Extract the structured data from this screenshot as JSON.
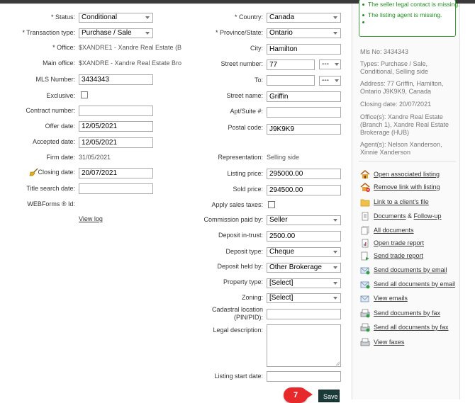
{
  "colors": {
    "accent_green": "#1f8f1f",
    "save_button_bg": "#1b3b3b",
    "step_badge": "#e8292c"
  },
  "left": {
    "status_label": "* Status:",
    "status_value": "Conditional",
    "transaction_type_label": "* Transaction type:",
    "transaction_type_value": "Purchase / Sale",
    "office_label": "* Office:",
    "office_value": "$XANDRE1 - Xandre Real Estate (Br...",
    "main_office_label": "Main office:",
    "main_office_value": "$XANDRE - Xandre Real Estate Bro...",
    "mls_label": "MLS Number:",
    "mls_value": "3434343",
    "exclusive_label": "Exclusive:",
    "contract_label": "Contract number:",
    "contract_value": "",
    "offer_label": "Offer date:",
    "offer_value": "12/05/2021",
    "accepted_label": "Accepted date:",
    "accepted_value": "12/05/2021",
    "firm_label": "Firm date:",
    "firm_value": "31/05/2021",
    "closing_label": "Closing date:",
    "closing_value": "20/07/2021",
    "title_search_label": "Title search date:",
    "title_search_value": "",
    "webforms_label": "WEBForms ® Id:",
    "view_log": "View log"
  },
  "right": {
    "country_label": "* Country:",
    "country_value": "Canada",
    "province_label": "* Province/State:",
    "province_value": "Ontario",
    "city_label": "City:",
    "city_value": "Hamilton",
    "street_number_label": "Street number:",
    "street_number_value": "77",
    "street_number_suffix": "---",
    "to_label": "To:",
    "to_value": "",
    "to_suffix": "---",
    "street_name_label": "Street name:",
    "street_name_value": "Griffin",
    "apt_label": "Apt/Suite #:",
    "apt_value": "",
    "postal_label": "Postal code:",
    "postal_value": "J9K9K9",
    "representation_label": "Representation:",
    "representation_value": "Selling side",
    "listing_price_label": "Listing price:",
    "listing_price_value": "295000.00",
    "sold_price_label": "Sold price:",
    "sold_price_value": "294500.00",
    "taxes_label": "Apply sales taxes:",
    "commission_label": "Commission paid by:",
    "commission_value": "Seller",
    "deposit_trust_label": "Deposit in-trust:",
    "deposit_trust_value": "2500.00",
    "deposit_type_label": "Deposit type:",
    "deposit_type_value": "Cheque",
    "deposit_held_label": "Deposit held by:",
    "deposit_held_value": "Other Brokerage",
    "property_type_label": "Property type:",
    "property_type_value": "[Select]",
    "zoning_label": "Zoning:",
    "zoning_value": "[Select]",
    "cadastral_label": "Cadastral location (PIN/PID):",
    "cadastral_value": "",
    "legal_label": "Legal description:",
    "listing_start_label": "Listing start date:",
    "listing_start_value": ""
  },
  "sidebar": {
    "alerts": [
      "The seller legal contact is missing.",
      "The listing agent is missing.",
      ""
    ],
    "mls": "Mls No:  3434343",
    "types": "Types:  Purchase / Sale, Conditional, Selling side",
    "address": "Address:  77 Griffin, Hamilton, Ontario J9K9K9, Canada",
    "closing": "Closing date:  20/07/2021",
    "offices": "Office(s):  Xandre Real Estate (Branch 1), Xandre Real Estate Brokerage (HUB)",
    "agents": "Agent(s):  Nelson Xanderson, Xinnie Xanderson",
    "actions": [
      {
        "label": "Open associated listing",
        "icon": "house-icon"
      },
      {
        "label": "Remove link with listing",
        "icon": "house-remove-icon"
      },
      {
        "label": "Link to a client's file",
        "icon": "client-file-icon"
      },
      {
        "label": "Documents",
        "label2": "Follow-up",
        "icon": "documents-icon"
      },
      {
        "label": "All documents",
        "icon": "all-documents-icon"
      },
      {
        "label": "Open trade report",
        "icon": "report-icon"
      },
      {
        "label": "Send trade report",
        "icon": "send-report-icon"
      },
      {
        "label": "Send documents by email",
        "icon": "email-icon"
      },
      {
        "label": "Send all documents by email",
        "icon": "email-all-icon"
      },
      {
        "label": "View emails",
        "icon": "view-email-icon"
      },
      {
        "label": "Send documents by fax",
        "icon": "fax-icon"
      },
      {
        "label": "Send all documents by fax",
        "icon": "fax-all-icon"
      },
      {
        "label": "View faxes",
        "icon": "view-fax-icon"
      }
    ]
  },
  "footer": {
    "step_number": "7",
    "save_label": "Save"
  }
}
